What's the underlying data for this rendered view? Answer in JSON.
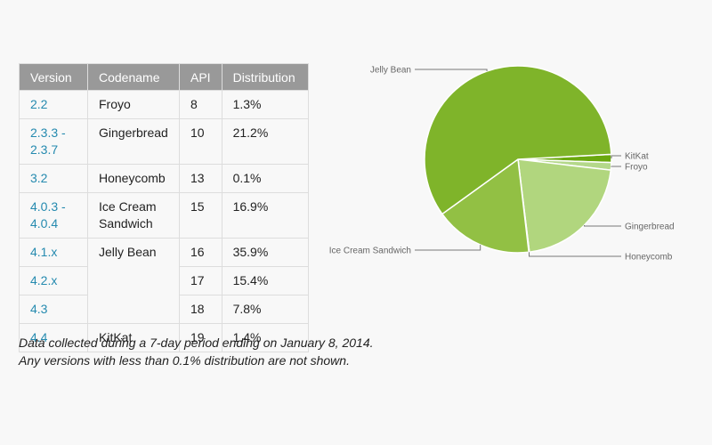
{
  "table": {
    "headers": [
      "Version",
      "Codename",
      "API",
      "Distribution"
    ],
    "rows": [
      {
        "version": "2.2",
        "codename": "Froyo",
        "api": "8",
        "distribution": "1.3%"
      },
      {
        "version": "2.3.3 - 2.3.7",
        "codename": "Gingerbread",
        "api": "10",
        "distribution": "21.2%"
      },
      {
        "version": "3.2",
        "codename": "Honeycomb",
        "api": "13",
        "distribution": "0.1%"
      },
      {
        "version": "4.0.3 - 4.0.4",
        "codename": "Ice Cream Sandwich",
        "api": "15",
        "distribution": "16.9%"
      },
      {
        "version": "4.1.x",
        "codename": "Jelly Bean",
        "api": "16",
        "distribution": "35.9%"
      },
      {
        "version": "4.2.x",
        "codename": "",
        "api": "17",
        "distribution": "15.4%"
      },
      {
        "version": "4.3",
        "codename": "",
        "api": "18",
        "distribution": "7.8%"
      },
      {
        "version": "4.4",
        "codename": "KitKat",
        "api": "19",
        "distribution": "1.4%"
      }
    ]
  },
  "notes": [
    "Data collected during a 7-day period ending on January 8, 2014.",
    "Any versions with less than 0.1% distribution are not shown."
  ],
  "chart_data": {
    "type": "pie",
    "title": "",
    "categories": [
      "KitKat",
      "Froyo",
      "Gingerbread",
      "Honeycomb",
      "Ice Cream Sandwich",
      "Jelly Bean"
    ],
    "values": [
      1.4,
      1.3,
      21.2,
      0.1,
      16.9,
      59.1
    ],
    "colors": [
      "#6aa80f",
      "#b4d88a",
      "#b1d67e",
      "#a7cf6e",
      "#92c044",
      "#7fb42a"
    ],
    "legend": "callout-labels"
  }
}
